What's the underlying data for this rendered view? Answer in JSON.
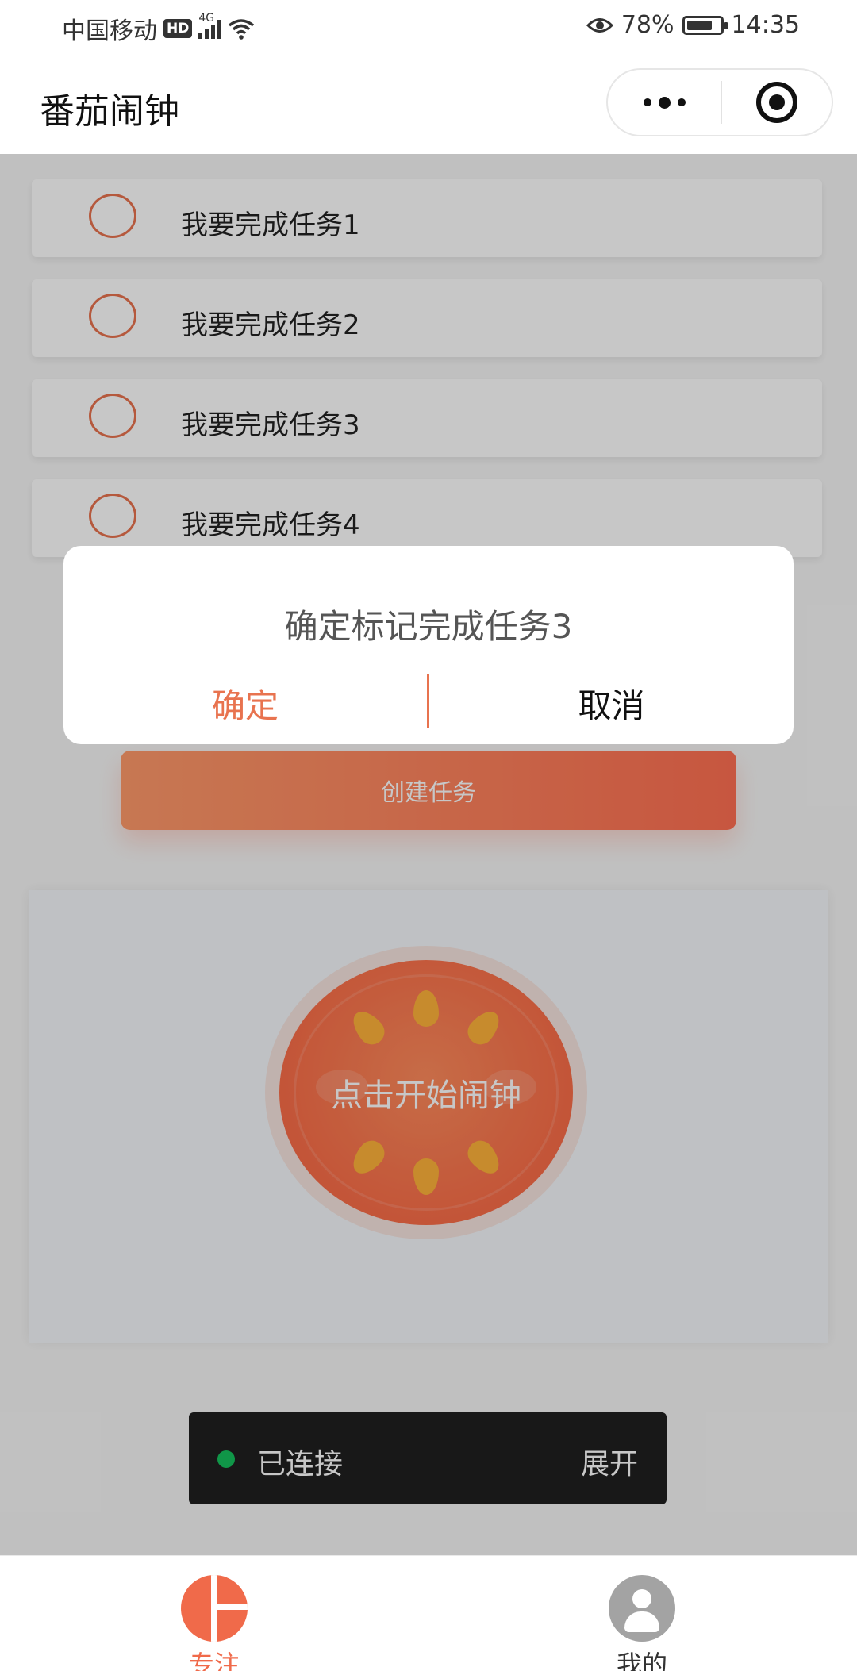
{
  "status_bar": {
    "carrier": "中国移动",
    "hd_badge": "HD",
    "network_type": "4G",
    "battery_percent": "78%",
    "battery_level": 0.78,
    "time": "14:35"
  },
  "nav_bar": {
    "title": "番茄闹钟"
  },
  "tasks": [
    {
      "label": "我要完成任务1"
    },
    {
      "label": "我要完成任务2"
    },
    {
      "label": "我要完成任务3"
    },
    {
      "label": "我要完成任务4"
    }
  ],
  "create_button": {
    "label": "创建任务"
  },
  "timer": {
    "start_label": "点击开始闹钟"
  },
  "connection": {
    "status": "已连接",
    "expand_label": "展开",
    "status_color": "#15c15d"
  },
  "dialog": {
    "title": "确定标记完成任务3",
    "confirm_label": "确定",
    "cancel_label": "取消"
  },
  "tab_bar": {
    "tabs": [
      {
        "label": "专注",
        "icon": "tomato-icon",
        "active": true
      },
      {
        "label": "我的",
        "icon": "user-avatar-icon",
        "active": false
      }
    ]
  },
  "colors": {
    "accent": "#f06a4a",
    "task_circle": "#e8734f",
    "create_gradient_start": "#ff9a6a",
    "create_gradient_end": "#ff6f52"
  }
}
